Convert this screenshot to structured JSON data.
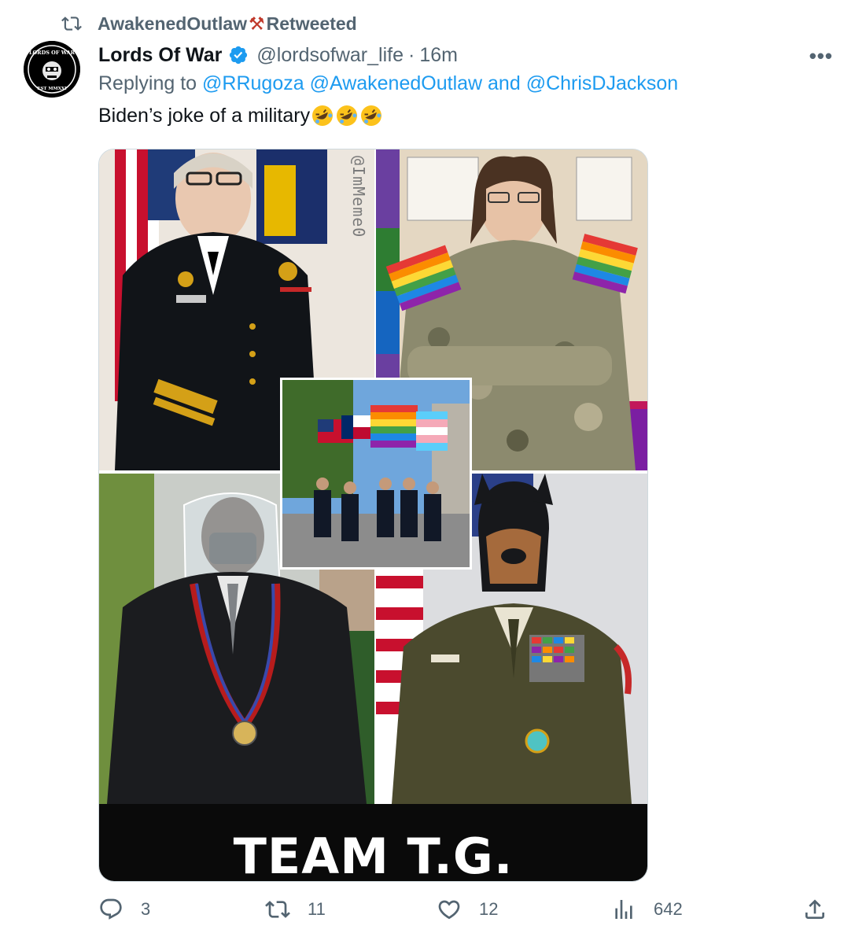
{
  "retweet": {
    "icon": "retweet-icon",
    "user": "AwakenedOutlaw",
    "hammer": "⚒",
    "label": "Retweeted"
  },
  "author": {
    "avatar_text_top": "LORDS OF WAR",
    "avatar_text_bottom": "EST MMXXI",
    "name": "Lords Of War",
    "verified_icon": "verified-badge-icon",
    "handle": "@lordsofwar_life",
    "dot": "·",
    "time": "16m"
  },
  "more_label": "•••",
  "reply": {
    "prefix": "Replying to",
    "mention1": "@RRugoza",
    "mention2": "@AwakenedOutlaw",
    "and": "and",
    "mention3": "@ChrisDJackson"
  },
  "tweet_text": "Biden’s joke of a military",
  "media": {
    "watermark": "@ImMeme0",
    "caption": "TEAM T.G."
  },
  "actions": {
    "replies": "3",
    "retweets": "11",
    "likes": "12",
    "views": "642"
  },
  "colors": {
    "link": "#1d9bf0",
    "muted": "#536471",
    "text": "#0f1419"
  }
}
